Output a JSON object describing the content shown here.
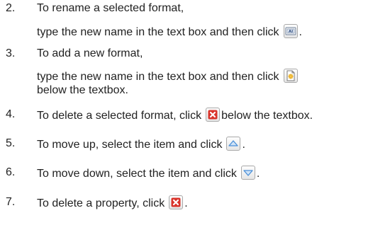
{
  "steps": [
    {
      "number": "2.",
      "lines": [
        "To rename a selected format,",
        "type the new name in the text box and then click"
      ],
      "icon": "rename-icon",
      "trailing": "."
    },
    {
      "number": "3.",
      "lines": [
        "To add a new format,",
        "type the new name in the text box and then click",
        "below the textbox."
      ],
      "icon": "add-format-icon"
    },
    {
      "number": "4.",
      "before": "To delete a selected format, click",
      "after": "below the textbox.",
      "icon": "delete-icon"
    },
    {
      "number": "5.",
      "before": "To move up, select the item and click",
      "after": ".",
      "icon": "move-up-icon"
    },
    {
      "number": "6.",
      "before": "To move down, select the item and click",
      "after": ".",
      "icon": "move-down-icon"
    },
    {
      "number": "7.",
      "before": "To delete a property, click",
      "after": ".",
      "icon": "delete-icon"
    }
  ],
  "colors": {
    "text": "#222222",
    "delete_red": "#d9342b",
    "arrow_blue": "#4a8fd8",
    "add_gold": "#e0a020"
  }
}
